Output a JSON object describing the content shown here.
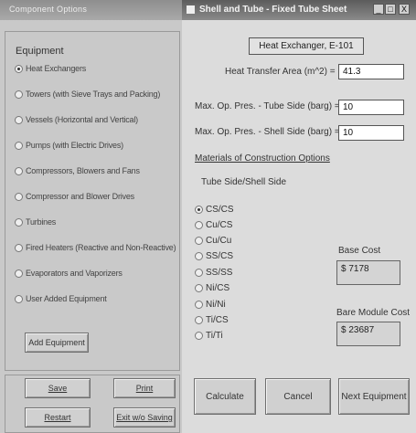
{
  "left_window": {
    "title": "Component Options",
    "group_label": "Equipment",
    "equipment_options": [
      {
        "label": "Heat Exchangers",
        "selected": true
      },
      {
        "label": "Towers (with Sieve Trays and Packing)",
        "selected": false
      },
      {
        "label": "Vessels (Horizontal and Vertical)",
        "selected": false
      },
      {
        "label": "Pumps (with Electric Drives)",
        "selected": false
      },
      {
        "label": "Compressors, Blowers and Fans",
        "selected": false
      },
      {
        "label": "Compressor and Blower Drives",
        "selected": false
      },
      {
        "label": "Turbines",
        "selected": false
      },
      {
        "label": "Fired Heaters (Reactive and Non-Reactive)",
        "selected": false
      },
      {
        "label": "Evaporators and Vaporizers",
        "selected": false
      },
      {
        "label": "User Added Equipment",
        "selected": false
      }
    ],
    "add_equipment_label": "Add Equipment",
    "save_label": "Save",
    "print_label": "Print",
    "restart_label": "Restart",
    "exit_label": "Exit w/o Saving"
  },
  "right_window": {
    "title": "Shell and Tube - Fixed Tube Sheet",
    "minimize_glyph": "_",
    "maximize_glyph": "□",
    "close_glyph": "X",
    "heading": "Heat Exchanger, E-101",
    "area_label": "Heat Transfer Area (m^2) =",
    "area_value": "41.3",
    "tube_pres_label": "Max. Op. Pres. - Tube Side (barg) =",
    "tube_pres_value": "10",
    "shell_pres_label": "Max. Op. Pres. - Shell Side (barg) =",
    "shell_pres_value": "10",
    "materials_heading": "Materials of Construction Options",
    "materials_subheading": "Tube Side/Shell Side",
    "materials": [
      {
        "label": "CS/CS",
        "selected": true
      },
      {
        "label": "Cu/CS",
        "selected": false
      },
      {
        "label": "Cu/Cu",
        "selected": false
      },
      {
        "label": "SS/CS",
        "selected": false
      },
      {
        "label": "SS/SS",
        "selected": false
      },
      {
        "label": "Ni/CS",
        "selected": false
      },
      {
        "label": "Ni/Ni",
        "selected": false
      },
      {
        "label": "Ti/CS",
        "selected": false
      },
      {
        "label": "Ti/Ti",
        "selected": false
      }
    ],
    "base_cost_label": "Base Cost",
    "base_cost_value": "$ 7178",
    "bare_module_label": "Bare Module Cost",
    "bare_module_value": "$ 23687",
    "calculate_label": "Calculate",
    "cancel_label": "Cancel",
    "next_label": "Next Equipment"
  }
}
